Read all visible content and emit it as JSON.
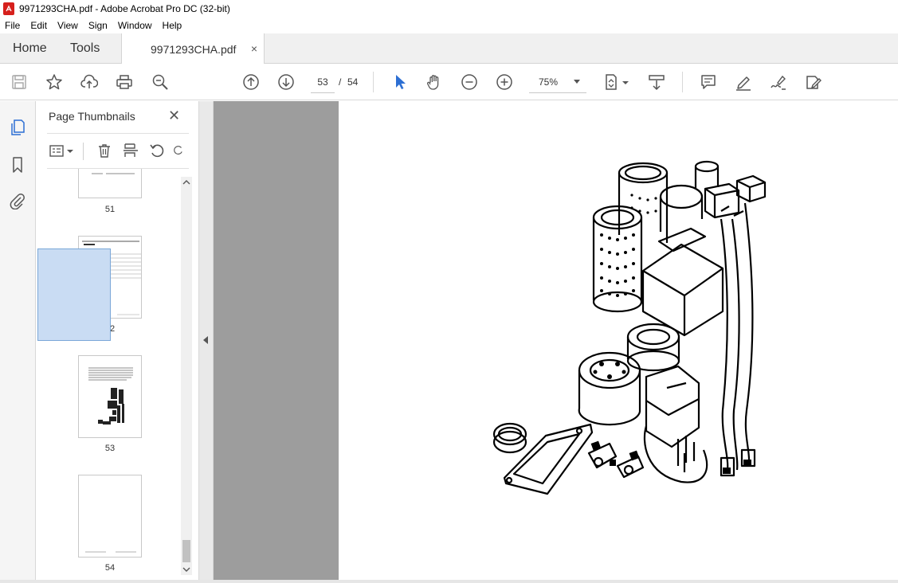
{
  "window": {
    "title": "9971293CHA.pdf - Adobe Acrobat Pro DC (32-bit)"
  },
  "menu": [
    "File",
    "Edit",
    "View",
    "Sign",
    "Window",
    "Help"
  ],
  "tabs": {
    "home": "Home",
    "tools": "Tools",
    "document": "9971293CHA.pdf",
    "close": "×"
  },
  "toolbar": {
    "current_page": "53",
    "separator": "/",
    "total_pages": "54",
    "zoom": "75%",
    "icons": [
      "save-icon",
      "star-icon",
      "upload-icon",
      "print-icon",
      "search-zoom-icon",
      "page-up-icon",
      "page-down-icon",
      "select-pointer-icon",
      "hand-icon",
      "zoom-out-icon",
      "zoom-in-icon",
      "page-fit-icon",
      "scroll-mode-icon",
      "comment-icon",
      "highlight-icon",
      "sign-icon",
      "fill-sign-icon"
    ]
  },
  "thumbnails_panel": {
    "title": "Page Thumbnails",
    "close": "✕",
    "pages": [
      {
        "label": "51",
        "selected": false
      },
      {
        "label": "52",
        "selected": false
      },
      {
        "label": "53",
        "selected": true
      },
      {
        "label": "54",
        "selected": false
      }
    ]
  },
  "colors": {
    "accent": "#2d6fd3",
    "pdf_red": "#d6201c",
    "doc_background": "#9d9d9d",
    "selection": "#c9dcf3"
  }
}
